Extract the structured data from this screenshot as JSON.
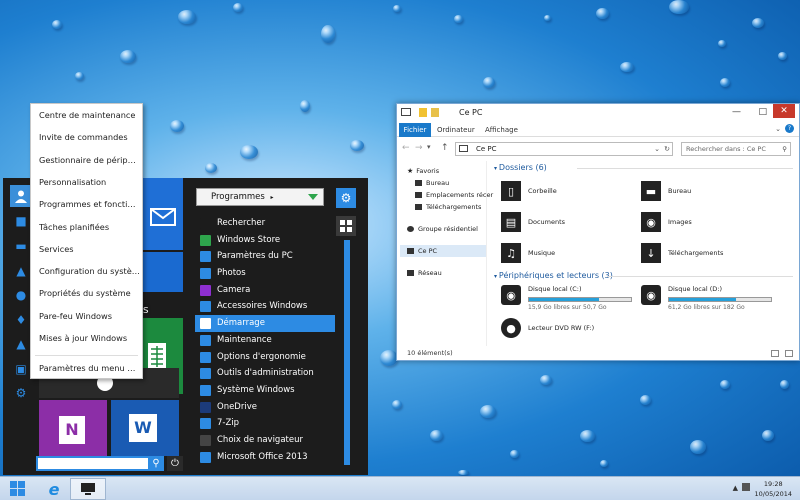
{
  "desktop": {
    "background_color": "#1e7fd0"
  },
  "context_menu": {
    "items": [
      "Centre de maintenance",
      "Invite de commandes",
      "Gestionnaire de périphéq...",
      "Personnalisation",
      "Programmes et fonctionna...",
      "Tâches planifiées",
      "Services",
      "Configuration du système",
      "Propriétés du système",
      "Pare-feu Windows",
      "Mises à jour Windows",
      "Paramètres du menu Dém..."
    ]
  },
  "start_menu": {
    "apps_label": "s apps",
    "programs_dropdown": "Programmes",
    "programs": [
      {
        "label": "Rechercher",
        "icon": "search-icon",
        "color": "#1c1c1c"
      },
      {
        "label": "Windows Store",
        "icon": "store-icon",
        "color": "#2ea54c"
      },
      {
        "label": "Paramètres du PC",
        "icon": "gear-icon",
        "color": "#2d8be3"
      },
      {
        "label": "Photos",
        "icon": "photos-icon",
        "color": "#2d8be3"
      },
      {
        "label": "Camera",
        "icon": "camera-icon",
        "color": "#8e2fd1"
      },
      {
        "label": "Accessoires Windows",
        "icon": "folder-icon",
        "color": "#2d8be3"
      },
      {
        "label": "Démarrage",
        "icon": "folder-icon",
        "color": "#ffffff"
      },
      {
        "label": "Maintenance",
        "icon": "folder-icon",
        "color": "#2d8be3"
      },
      {
        "label": "Options d'ergonomie",
        "icon": "folder-icon",
        "color": "#2d8be3"
      },
      {
        "label": "Outils d'administration",
        "icon": "folder-icon",
        "color": "#2d8be3"
      },
      {
        "label": "Système Windows",
        "icon": "folder-icon",
        "color": "#2d8be3"
      },
      {
        "label": "OneDrive",
        "icon": "cloud-icon",
        "color": "#1c3b7a"
      },
      {
        "label": "7-Zip",
        "icon": "folder-icon",
        "color": "#2d8be3"
      },
      {
        "label": "Choix de navigateur",
        "icon": "browser-icon",
        "color": "#444444"
      },
      {
        "label": "Microsoft Office 2013",
        "icon": "folder-icon",
        "color": "#2d8be3"
      }
    ],
    "active_index": 6,
    "tiles": {
      "onenote_label": "N",
      "word_label": "W"
    }
  },
  "explorer": {
    "title": "Ce PC",
    "tabs": [
      "Fichier",
      "Ordinateur",
      "Affichage"
    ],
    "address": "Ce PC",
    "search_placeholder": "Rechercher dans : Ce PC",
    "nav": {
      "favorites": "Favoris",
      "fav_items": [
        "Bureau",
        "Emplacements récer",
        "Téléchargements"
      ],
      "homegroup": "Groupe résidentiel",
      "this_pc": "Ce PC",
      "network": "Réseau"
    },
    "folders_header": "Dossiers (6)",
    "folders": [
      {
        "label": "Corbeille",
        "icon": "trash-icon"
      },
      {
        "label": "Bureau",
        "icon": "desktop-icon"
      },
      {
        "label": "Documents",
        "icon": "document-icon"
      },
      {
        "label": "Images",
        "icon": "camera-icon"
      },
      {
        "label": "Musique",
        "icon": "music-icon"
      },
      {
        "label": "Téléchargements",
        "icon": "download-icon"
      }
    ],
    "devices_header": "Périphériques et lecteurs (3)",
    "drives": [
      {
        "label": "Disque local (C:)",
        "sub": "15,9 Go libres sur 50,7 Go",
        "used_fraction": 0.69
      },
      {
        "label": "Disque local (D:)",
        "sub": "61,2 Go libres sur 182 Go",
        "used_fraction": 0.66
      }
    ],
    "dvd": "Lecteur DVD RW (F:)",
    "status": "10 élément(s)"
  },
  "taskbar": {
    "time": "19:28",
    "date": "10/05/2014"
  },
  "colors": {
    "accent": "#2d8be3",
    "start_bg": "#1c1c1c",
    "green": "#2ea54c"
  }
}
